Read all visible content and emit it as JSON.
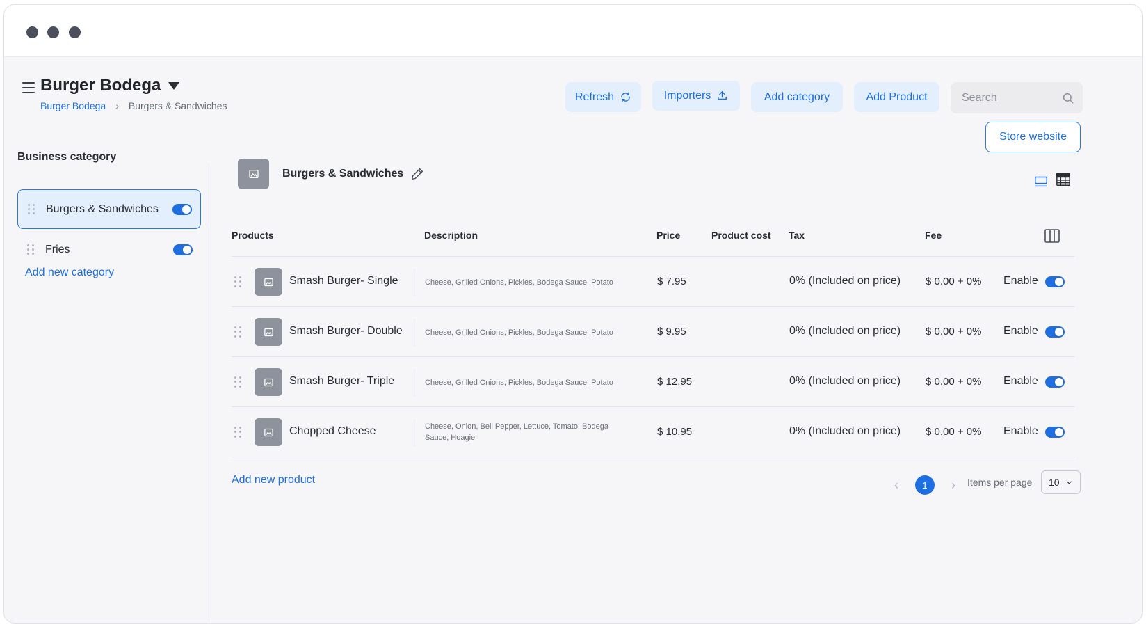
{
  "header": {
    "store_name": "Burger Bodega",
    "breadcrumb": [
      "Burger Bodega",
      "Burgers & Sandwiches"
    ],
    "buttons": {
      "refresh": "Refresh",
      "importers": "Importers",
      "add_category": "Add category",
      "add_product": "Add Product",
      "store_website": "Store website"
    },
    "search": {
      "placeholder": "Search"
    }
  },
  "sidebar": {
    "heading": "Business category",
    "categories": [
      {
        "label": "Burgers & Sandwiches",
        "enabled": true,
        "selected": true
      },
      {
        "label": "Fries",
        "enabled": true,
        "selected": false
      }
    ],
    "add_category_link": "Add new category"
  },
  "category_view": {
    "title": "Burgers & Sandwiches"
  },
  "table": {
    "columns": [
      "Products",
      "Description",
      "Price",
      "Product cost",
      "Tax",
      "Fee"
    ],
    "rows": [
      {
        "name": "Smash Burger- Single",
        "description": "Cheese, Grilled Onions, Pickles, Bodega Sauce, Potato",
        "price": "$ 7.95",
        "tax": "0% (Included on price)",
        "fee": "$ 0.00 + 0%",
        "status": "Enable",
        "enabled": true
      },
      {
        "name": "Smash Burger- Double",
        "description": "Cheese, Grilled Onions, Pickles, Bodega Sauce, Potato",
        "price": "$ 9.95",
        "tax": "0% (Included on price)",
        "fee": "$ 0.00 + 0%",
        "status": "Enable",
        "enabled": true
      },
      {
        "name": "Smash Burger- Triple",
        "description": "Cheese, Grilled Onions, Pickles, Bodega Sauce, Potato",
        "price": "$ 12.95",
        "tax": "0% (Included on price)",
        "fee": "$ 0.00 + 0%",
        "status": "Enable",
        "enabled": true
      },
      {
        "name": "Chopped Cheese",
        "description": "Cheese, Onion, Bell Pepper, Lettuce, Tomato, Bodega Sauce, Hoagie",
        "price": "$ 10.95",
        "tax": "0% (Included on price)",
        "fee": "$ 0.00 + 0%",
        "status": "Enable",
        "enabled": true
      }
    ],
    "add_product_link": "Add new product"
  },
  "pagination": {
    "current_page": "1",
    "items_per_page_label": "Items per page",
    "items_per_page": "10"
  },
  "colors": {
    "accent": "#1f6fe0",
    "accent_light": "#e3effc",
    "background": "#f6f6f8"
  }
}
